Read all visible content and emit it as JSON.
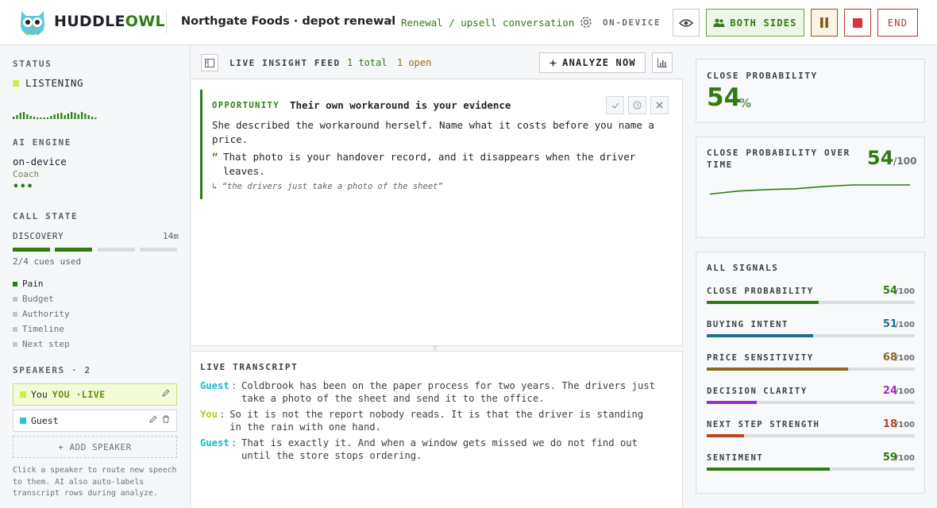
{
  "header": {
    "brand_a": "HUDDLE",
    "brand_b": "OWL",
    "title": "Northgate Foods · depot renewal",
    "sep": "·",
    "subtitle": "Renewal / upsell conversation",
    "mode": "ON-DEVICE",
    "both_sides": "BOTH SIDES",
    "end": "END",
    "icons": [
      "gear-icon",
      "eye-icon",
      "people-icon",
      "pause-icon",
      "stop-icon"
    ]
  },
  "sidebar": {
    "status_h": "STATUS",
    "status": "LISTENING",
    "engine_h": "AI ENGINE",
    "engine": "on-device",
    "engine_sub": "Coach",
    "engine_dots": "•••",
    "call_h": "CALL STATE",
    "phase": "DISCOVERY",
    "elapsed": "14m",
    "cue_progress": {
      "used": 2,
      "total": 4
    },
    "cues_used": "2/4 cues used",
    "cues": [
      {
        "label": "Pain",
        "on": true
      },
      {
        "label": "Budget",
        "on": false
      },
      {
        "label": "Authority",
        "on": false
      },
      {
        "label": "Timeline",
        "on": false
      },
      {
        "label": "Next step",
        "on": false
      }
    ],
    "speakers_h": "SPEAKERS · 2",
    "speakers": [
      {
        "name": "You",
        "tag": "YOU ·LIVE",
        "color": "#c7f04a"
      },
      {
        "name": "Guest",
        "tag": "",
        "color": "#22c4e0"
      }
    ],
    "add_speaker": "+ ADD SPEAKER",
    "help": "Click a speaker to route new speech to them. AI also auto-labels transcript rows during analyze."
  },
  "feed": {
    "title": "LIVE INSIGHT FEED",
    "total": "1 total",
    "open": "1 open",
    "analyze": "ANALYZE NOW",
    "card": {
      "tag": "OPPORTUNITY",
      "title": "Their own workaround is your evidence",
      "body": "She described the workaround herself. Name what it costs before you name a price.",
      "quote_mark": "“",
      "quote": "That photo is your handover record, and it disappears when the driver leaves.",
      "source": "↳ “the drivers just take a photo of the sheet”"
    }
  },
  "transcript": {
    "title": "LIVE TRANSCRIPT",
    "rows": [
      {
        "who": "Guest",
        "color": "#17b8d6",
        "text": "Coldbrook has been on the paper process for two years. The drivers just take a photo of the sheet and send it to the office."
      },
      {
        "who": "You",
        "color": "#a9d21e",
        "text": "So it is not the report nobody reads. It is that the driver is standing in the rain with one hand."
      },
      {
        "who": "Guest",
        "color": "#17b8d6",
        "text": "That is exactly it. And when a window gets missed we do not find out until the store stops ordering."
      }
    ]
  },
  "right": {
    "close_h": "CLOSE PROBABILITY",
    "close_val": "54",
    "close_unit": "%",
    "over_time_h": "CLOSE PROBABILITY OVER TIME",
    "over_time_val": "54",
    "over_time_den": "/100",
    "trend": [
      38,
      42,
      44,
      45,
      48,
      50,
      51,
      54
    ],
    "signals_h": "ALL SIGNALS",
    "signals": [
      {
        "label": "CLOSE PROBABILITY",
        "value": 54,
        "den": "/100",
        "color": "#2e7d12"
      },
      {
        "label": "BUYING INTENT",
        "value": 51,
        "den": "/100",
        "color": "#1f6f8b"
      },
      {
        "label": "PRICE SENSITIVITY",
        "value": 68,
        "den": "/100",
        "color": "#8b6a1c"
      },
      {
        "label": "DECISION CLARITY",
        "value": 24,
        "den": "/100",
        "color": "#9b30c9"
      },
      {
        "label": "NEXT STEP STRENGTH",
        "value": 18,
        "den": "/100",
        "color": "#b5481f"
      },
      {
        "label": "SENTIMENT",
        "value": 59,
        "den": "/100",
        "color": "#2e7d12"
      }
    ]
  }
}
